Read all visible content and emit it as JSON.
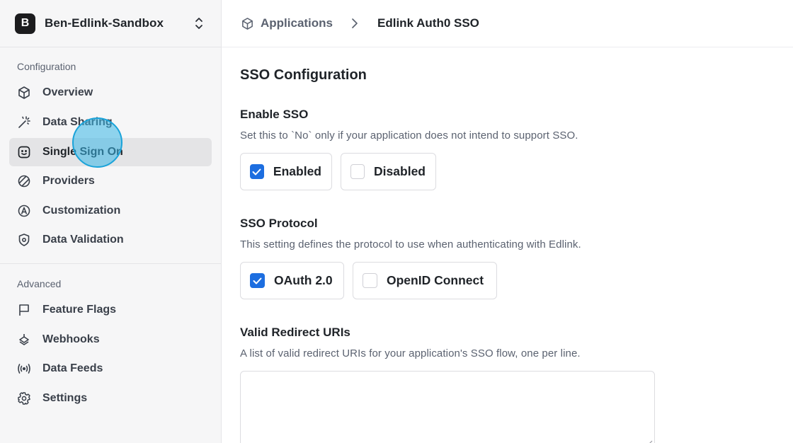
{
  "workspace": {
    "initial": "B",
    "name": "Ben-Edlink-Sandbox"
  },
  "sidebar": {
    "configuration_label": "Configuration",
    "advanced_label": "Advanced",
    "config_items": [
      {
        "label": "Overview",
        "icon": "cube-icon"
      },
      {
        "label": "Data Sharing",
        "icon": "magic-wand-icon"
      },
      {
        "label": "Single Sign On",
        "icon": "smiley-icon",
        "active": true
      },
      {
        "label": "Providers",
        "icon": "providers-icon"
      },
      {
        "label": "Customization",
        "icon": "customization-icon"
      },
      {
        "label": "Data Validation",
        "icon": "shield-icon"
      }
    ],
    "advanced_items": [
      {
        "label": "Feature Flags",
        "icon": "flag-icon"
      },
      {
        "label": "Webhooks",
        "icon": "webhook-icon"
      },
      {
        "label": "Data Feeds",
        "icon": "broadcast-icon"
      },
      {
        "label": "Settings",
        "icon": "gear-icon"
      }
    ]
  },
  "breadcrumb": {
    "parent": "Applications",
    "current": "Edlink Auth0 SSO"
  },
  "main": {
    "title": "SSO Configuration",
    "enable_sso": {
      "label": "Enable SSO",
      "description": "Set this to `No` only if your application does not intend to support SSO.",
      "options": [
        {
          "label": "Enabled",
          "checked": true
        },
        {
          "label": "Disabled",
          "checked": false
        }
      ]
    },
    "sso_protocol": {
      "label": "SSO Protocol",
      "description": "This setting defines the protocol to use when authenticating with Edlink.",
      "options": [
        {
          "label": "OAuth 2.0",
          "checked": true
        },
        {
          "label": "OpenID Connect",
          "checked": false
        }
      ]
    },
    "redirect_uris": {
      "label": "Valid Redirect URIs",
      "description": "A list of valid redirect URIs for your application's SSO flow, one per line.",
      "value": ""
    }
  },
  "colors": {
    "accent": "#1d6ee0",
    "sidebar_bg": "#f6f6f7",
    "active_bg": "#e4e4e6",
    "cursor": "#38b6e6"
  }
}
